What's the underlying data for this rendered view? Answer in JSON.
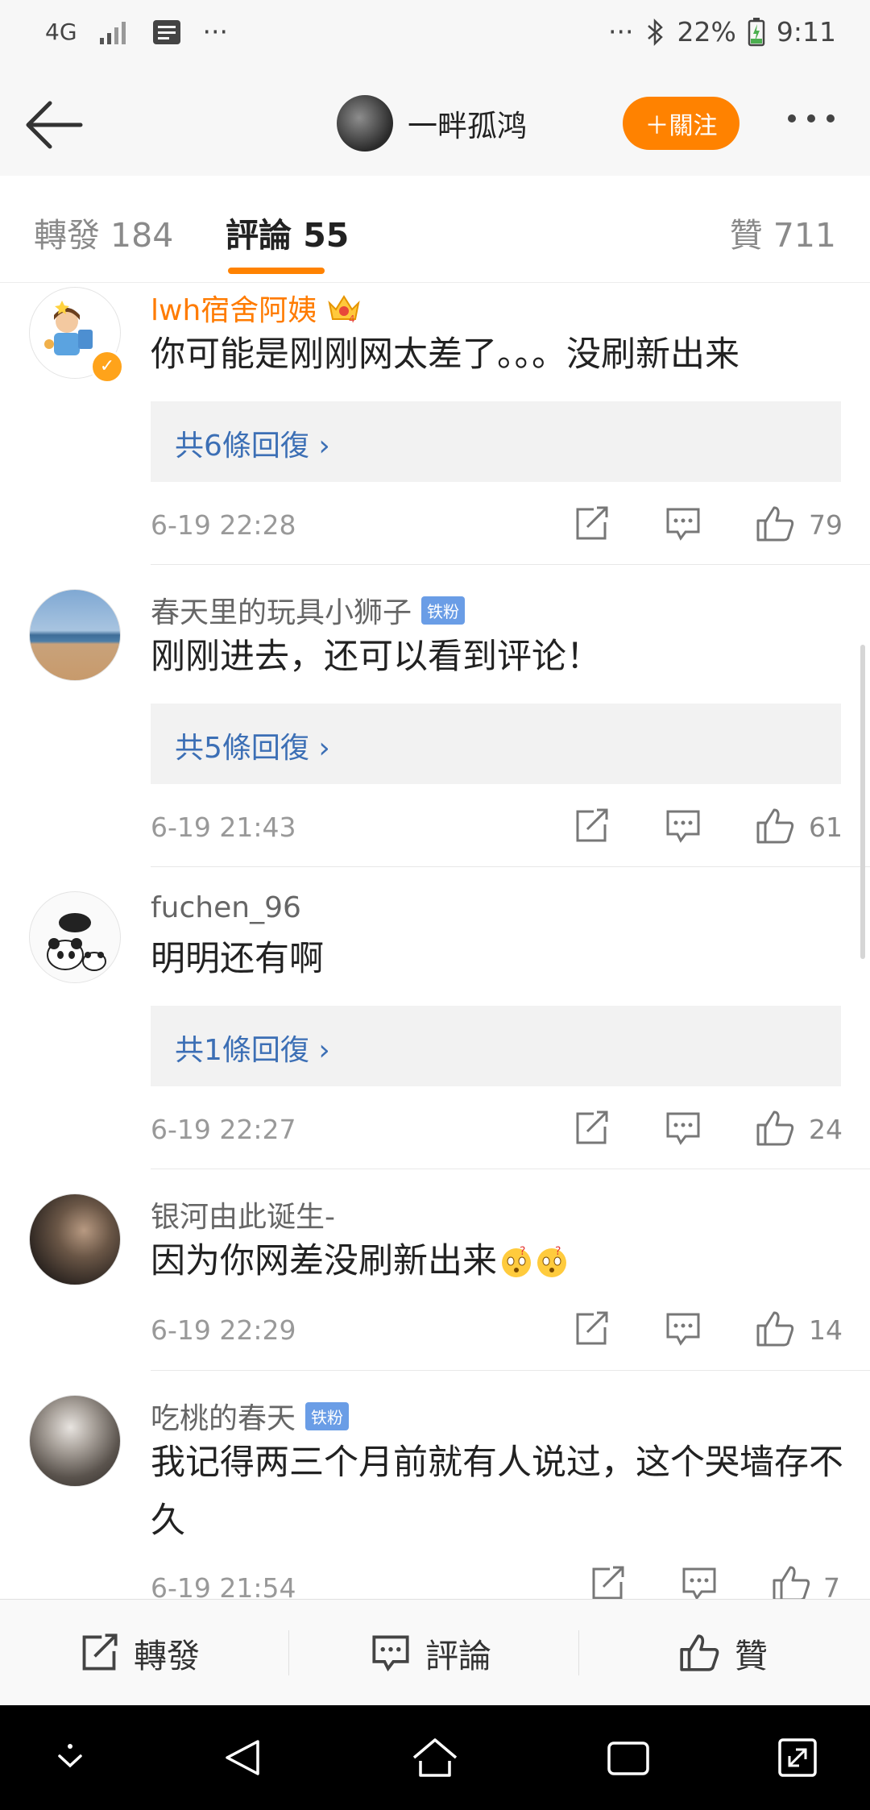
{
  "status_bar": {
    "network": "4G",
    "signal_icon": "signal-icon",
    "left_dots": "···",
    "right_dots": "···",
    "bluetooth_icon": "bluetooth-icon",
    "battery": "22%",
    "time": "9:11"
  },
  "header": {
    "title": "一畔孤鸿",
    "follow_label": "＋關注"
  },
  "tabs": {
    "repost_label": "轉發",
    "repost_count": "184",
    "comment_label": "評論",
    "comment_count": "55",
    "like_label": "贊",
    "like_count": "711"
  },
  "comments": [
    {
      "username": "lwh宿舍阿姨",
      "text": "你可能是刚刚网太差了。。。没刷新出来",
      "reply_label": "共6條回復 ›",
      "time": "6-19 22:28",
      "likes": "79"
    },
    {
      "username": "春天里的玩具小狮子",
      "badge": "铁粉",
      "text": "刚刚进去，还可以看到评论！",
      "reply_label": "共5條回復 ›",
      "time": "6-19 21:43",
      "likes": "61"
    },
    {
      "username": "fuchen_96",
      "text": "明明还有啊",
      "reply_label": "共1條回復 ›",
      "time": "6-19 22:27",
      "likes": "24"
    },
    {
      "username": "银河由此诞生-",
      "text": "因为你网差没刷新出来",
      "time": "6-19 22:29",
      "likes": "14"
    },
    {
      "username": "吃桃的春天",
      "badge": "铁粉",
      "text": "我记得两三个月前就有人说过，这个哭墙存不久",
      "time": "6-19 21:54",
      "likes": "7"
    }
  ],
  "bottom_bar": {
    "repost": "轉發",
    "comment": "評論",
    "like": "贊"
  },
  "colors": {
    "accent": "#ff8200",
    "link": "#3c6fb5",
    "badge": "#6a9de6"
  }
}
